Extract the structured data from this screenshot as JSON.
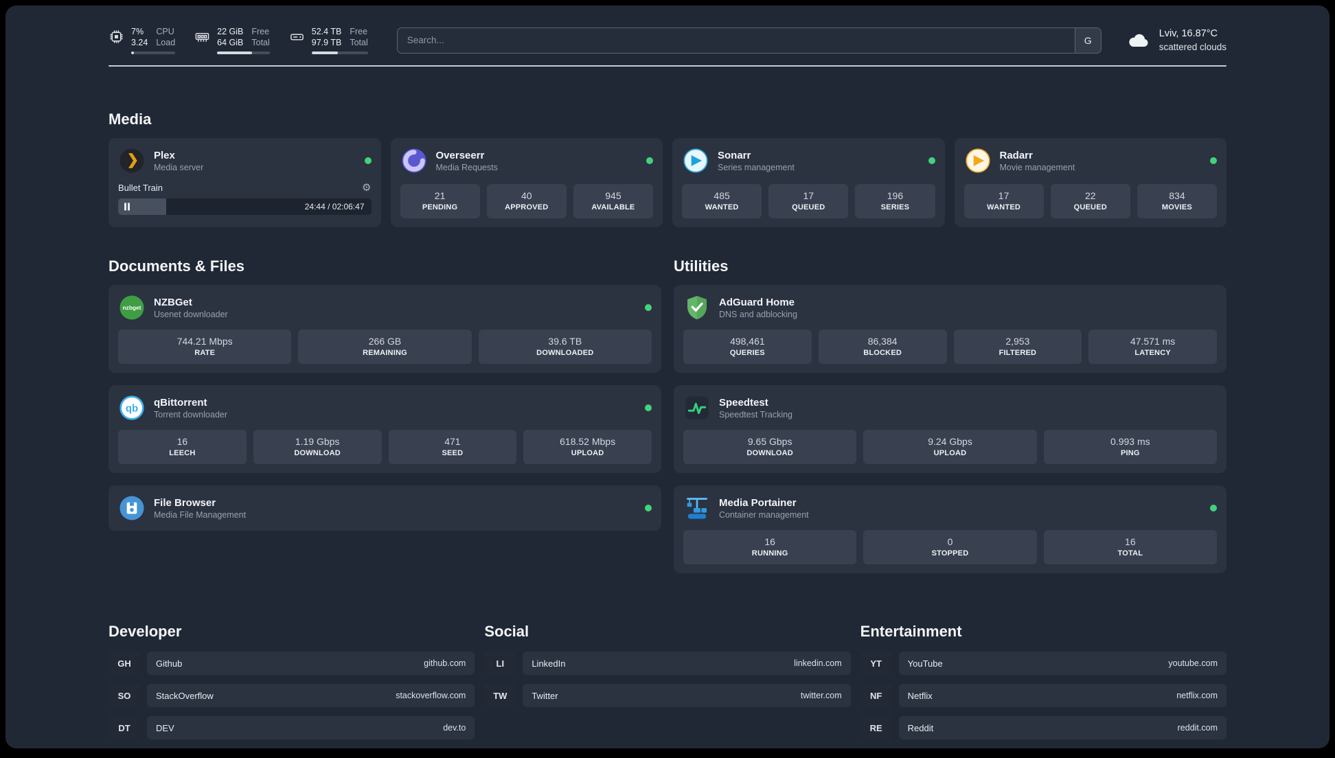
{
  "colors": {
    "background": "#212835",
    "card": "#2b3240",
    "stat_tile": "#39404f",
    "status_online": "#43d27c",
    "plex_accent": "#e5a00d",
    "adguard_green": "#63b568",
    "speedtest_green": "#35d07f",
    "portainer_blue": "#2f9ae0"
  },
  "topbar": {
    "cpu": {
      "value1": "7%",
      "value2": "3.24",
      "label1": "CPU",
      "label2": "Load",
      "bar_percent": 7
    },
    "memory": {
      "value1": "22 GiB",
      "value2": "64 GiB",
      "label1": "Free",
      "label2": "Total",
      "bar_percent": 66
    },
    "disk": {
      "value1": "52.4 TB",
      "value2": "97.9 TB",
      "label1": "Free",
      "label2": "Total",
      "bar_percent": 47
    },
    "search": {
      "placeholder": "Search...",
      "button_label": "G"
    },
    "weather": {
      "location": "Lviv, 16.87°C",
      "condition": "scattered clouds"
    }
  },
  "media": {
    "heading": "Media",
    "plex": {
      "title": "Plex",
      "subtitle": "Media server",
      "now_playing": "Bullet Train",
      "time": "24:44 / 02:06:47",
      "progress_percent": 19
    },
    "overseerr": {
      "title": "Overseerr",
      "subtitle": "Media Requests",
      "stats": [
        {
          "value": "21",
          "label": "PENDING"
        },
        {
          "value": "40",
          "label": "APPROVED"
        },
        {
          "value": "945",
          "label": "AVAILABLE"
        }
      ]
    },
    "sonarr": {
      "title": "Sonarr",
      "subtitle": "Series management",
      "stats": [
        {
          "value": "485",
          "label": "WANTED"
        },
        {
          "value": "17",
          "label": "QUEUED"
        },
        {
          "value": "196",
          "label": "SERIES"
        }
      ]
    },
    "radarr": {
      "title": "Radarr",
      "subtitle": "Movie management",
      "stats": [
        {
          "value": "17",
          "label": "WANTED"
        },
        {
          "value": "22",
          "label": "QUEUED"
        },
        {
          "value": "834",
          "label": "MOVIES"
        }
      ]
    }
  },
  "documents": {
    "heading": "Documents & Files",
    "nzbget": {
      "title": "NZBGet",
      "subtitle": "Usenet downloader",
      "stats": [
        {
          "value": "744.21 Mbps",
          "label": "RATE"
        },
        {
          "value": "266 GB",
          "label": "REMAINING"
        },
        {
          "value": "39.6 TB",
          "label": "DOWNLOADED"
        }
      ]
    },
    "qbittorrent": {
      "title": "qBittorrent",
      "subtitle": "Torrent downloader",
      "stats": [
        {
          "value": "16",
          "label": "LEECH"
        },
        {
          "value": "1.19 Gbps",
          "label": "DOWNLOAD"
        },
        {
          "value": "471",
          "label": "SEED"
        },
        {
          "value": "618.52 Mbps",
          "label": "UPLOAD"
        }
      ]
    },
    "filebrowser": {
      "title": "File Browser",
      "subtitle": "Media File Management"
    }
  },
  "utilities": {
    "heading": "Utilities",
    "adguard": {
      "title": "AdGuard Home",
      "subtitle": "DNS and adblocking",
      "stats": [
        {
          "value": "498,461",
          "label": "QUERIES"
        },
        {
          "value": "86,384",
          "label": "BLOCKED"
        },
        {
          "value": "2,953",
          "label": "FILTERED"
        },
        {
          "value": "47.571 ms",
          "label": "LATENCY"
        }
      ]
    },
    "speedtest": {
      "title": "Speedtest",
      "subtitle": "Speedtest Tracking",
      "stats": [
        {
          "value": "9.65 Gbps",
          "label": "DOWNLOAD"
        },
        {
          "value": "9.24 Gbps",
          "label": "UPLOAD"
        },
        {
          "value": "0.993 ms",
          "label": "PING"
        }
      ]
    },
    "portainer": {
      "title": "Media Portainer",
      "subtitle": "Container management",
      "stats": [
        {
          "value": "16",
          "label": "RUNNING"
        },
        {
          "value": "0",
          "label": "STOPPED"
        },
        {
          "value": "16",
          "label": "TOTAL"
        }
      ]
    }
  },
  "bookmarks": {
    "developer": {
      "heading": "Developer",
      "items": [
        {
          "abbr": "GH",
          "name": "Github",
          "url": "github.com"
        },
        {
          "abbr": "SO",
          "name": "StackOverflow",
          "url": "stackoverflow.com"
        },
        {
          "abbr": "DT",
          "name": "DEV",
          "url": "dev.to"
        }
      ]
    },
    "social": {
      "heading": "Social",
      "items": [
        {
          "abbr": "LI",
          "name": "LinkedIn",
          "url": "linkedin.com"
        },
        {
          "abbr": "TW",
          "name": "Twitter",
          "url": "twitter.com"
        }
      ]
    },
    "entertainment": {
      "heading": "Entertainment",
      "items": [
        {
          "abbr": "YT",
          "name": "YouTube",
          "url": "youtube.com"
        },
        {
          "abbr": "NF",
          "name": "Netflix",
          "url": "netflix.com"
        },
        {
          "abbr": "RE",
          "name": "Reddit",
          "url": "reddit.com"
        }
      ]
    }
  }
}
